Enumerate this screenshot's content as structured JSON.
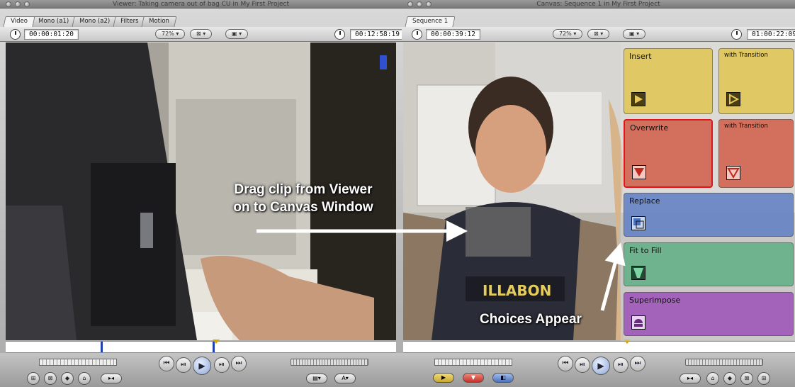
{
  "viewer": {
    "title": "Viewer: Taking camera out of bag CU in My First Project",
    "tabs": [
      "Video",
      "Mono (a1)",
      "Mono (a2)",
      "Filters",
      "Motion"
    ],
    "timecode_left": "00:00:01:20",
    "zoom": "72%",
    "timecode_right": "00:12:58:19"
  },
  "canvas": {
    "title": "Canvas: Sequence 1 in My First Project",
    "tabs": [
      "Sequence 1"
    ],
    "timecode_left": "00:00:39:12",
    "zoom": "72%",
    "timecode_right": "01:00:22:09"
  },
  "edit_overlay": {
    "insert": "Insert",
    "insert_transition": "with Transition",
    "overwrite": "Overwrite",
    "overwrite_transition": "with Transition",
    "replace": "Replace",
    "fit_to_fill": "Fit to Fill",
    "superimpose": "Superimpose",
    "colors": {
      "insert": "#d8c35a",
      "overwrite": "#cf6452",
      "replace": "#6a86c0",
      "fit": "#6bb08a",
      "superimpose": "#a05ab8",
      "highlight": "#e0141c"
    }
  },
  "annotations": {
    "drag_text_line1": "Drag clip from Viewer",
    "drag_text_line2": "on to Canvas Window",
    "choices_text": "Choices Appear"
  }
}
